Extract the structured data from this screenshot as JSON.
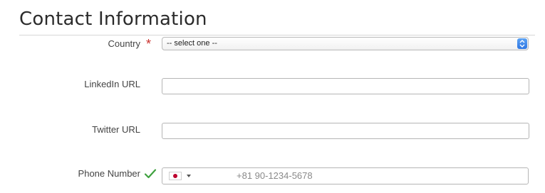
{
  "section": {
    "title": "Contact Information"
  },
  "fields": {
    "country": {
      "label": "Country",
      "required_marker": "*",
      "selected_value": "-- select one --"
    },
    "linkedin": {
      "label": "LinkedIn URL",
      "value": ""
    },
    "twitter": {
      "label": "Twitter URL",
      "value": ""
    },
    "phone": {
      "label": "Phone Number",
      "country_flag": "japan-flag-icon",
      "placeholder": "+81 90-1234-5678",
      "value": "",
      "valid": true
    }
  },
  "colors": {
    "required_marker": "#c9302c",
    "valid_check": "#3fa13f",
    "select_arrow_accent": "#3b82ea",
    "japan_flag_disc": "#bc002d"
  }
}
